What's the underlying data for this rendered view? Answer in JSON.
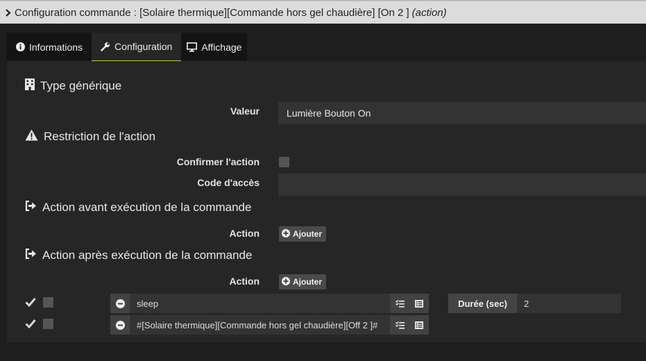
{
  "title": {
    "main": "Configuration commande : [Solaire thermique][Commande hors gel chaudière] [On 2 ]",
    "suffix": "(action)"
  },
  "tabs": [
    {
      "label": "Informations",
      "icon": "info-circle-icon"
    },
    {
      "label": "Configuration",
      "icon": "wrench-icon",
      "active": true
    },
    {
      "label": "Affichage",
      "icon": "monitor-icon"
    }
  ],
  "generic": {
    "title": "Type générique",
    "valeur_label": "Valeur",
    "valeur_value": "Lumière Bouton On"
  },
  "restriction": {
    "title": "Restriction de l'action",
    "confirm_label": "Confirmer l'action",
    "code_label": "Code d'accès"
  },
  "before": {
    "title": "Action avant exécution de la commande",
    "action_label": "Action",
    "add_label": "Ajouter"
  },
  "after": {
    "title": "Action après exécution de la commande",
    "action_label": "Action",
    "add_label": "Ajouter",
    "rows": [
      {
        "command": "sleep",
        "duration_label": "Durée (sec)",
        "duration_value": "2",
        "enabled": true
      },
      {
        "command": "#[Solaire thermique][Commande hors gel chaudière][Off 2 ]#",
        "enabled": true
      }
    ]
  },
  "colors": {
    "active_tab_underline": "#b8d14c",
    "background": "#1e1e1e",
    "panel": "#262626",
    "titlebar": "#dcdcdc"
  }
}
